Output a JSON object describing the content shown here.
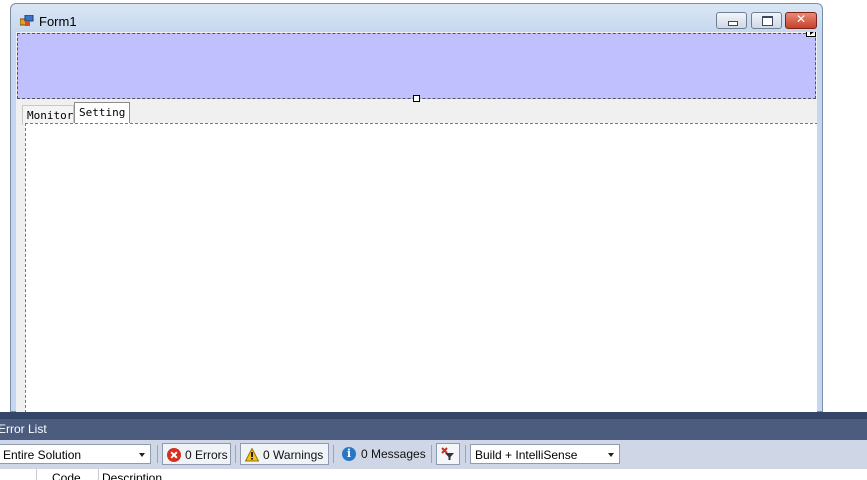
{
  "form": {
    "title": "Form1",
    "tabs": [
      {
        "label": "Monitor",
        "selected": false
      },
      {
        "label": "Setting",
        "selected": true
      }
    ],
    "panel_color": "#c0c0ff",
    "close_glyph": "✕"
  },
  "error_list": {
    "title": "Error List",
    "scope": "Entire Solution",
    "errors_label": "0 Errors",
    "warnings_label": "0 Warnings",
    "messages_label": "0 Messages",
    "build_filter": "Build + IntelliSense",
    "columns": [
      "Code",
      "Description"
    ],
    "icons": [
      "error-icon",
      "warning-icon",
      "info-icon",
      "filter-icon"
    ]
  }
}
